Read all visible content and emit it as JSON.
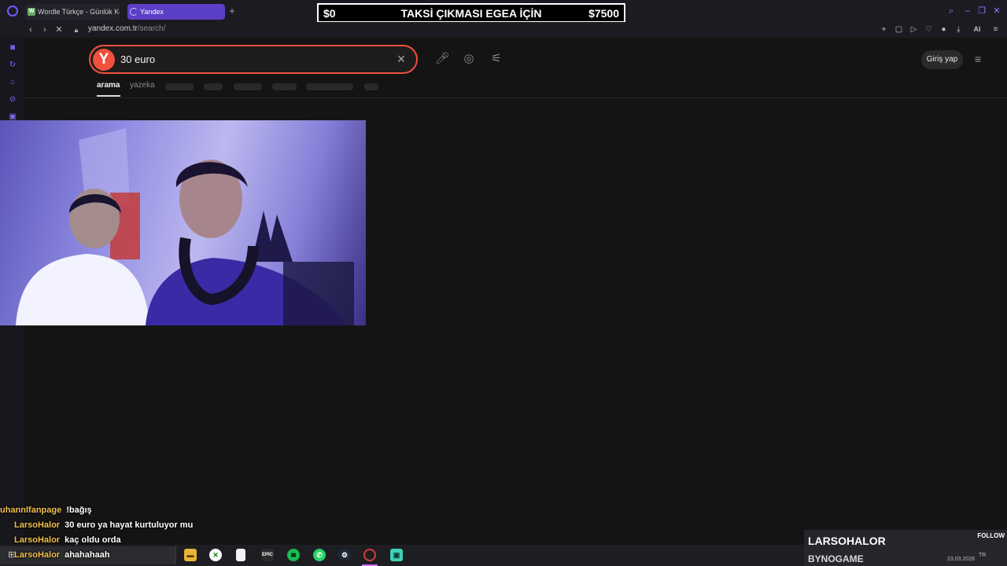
{
  "browser": {
    "tabs": [
      {
        "title": "Wordle Türkçe - Günlük Ke",
        "active": false
      },
      {
        "title": "Yandex",
        "active": true
      }
    ],
    "new_tab": "+",
    "url_domain": "yandex.com.tr",
    "url_path": "/search/",
    "ai_label": "AI"
  },
  "overlay_banner": {
    "left": "$0",
    "center": "TAKSİ ÇIKMASI EGEA İÇİN",
    "right": "$7500"
  },
  "search": {
    "logo": "Y",
    "query": "30 euro",
    "login_label": "Giriş yap",
    "tabs": [
      "arama",
      "yazeka"
    ],
    "accent_color": "#f0503d"
  },
  "chat": [
    {
      "user": "uhannlfanpage",
      "message": "!bağış"
    },
    {
      "user": "LarsoHalor",
      "message": "30 euro ya hayat kurtuluyor mu"
    },
    {
      "user": "LarsoHalor",
      "message": "kaç oldu orda"
    },
    {
      "user": "LarsoHalor",
      "message": "ahahahaah"
    }
  ],
  "follow_overlay": {
    "name": "LARSOHALOR",
    "label": "FOLLOW",
    "sub": "BYNOGAME"
  },
  "tray": {
    "date": "23.03.2026",
    "lang": "TR"
  },
  "icons": {
    "taskbar": [
      "file-explorer-icon",
      "xbox-icon",
      "notepad-icon",
      "epic-games-icon",
      "spotify-icon",
      "whatsapp-icon",
      "steam-icon",
      "opera-icon",
      "app-icon"
    ]
  }
}
